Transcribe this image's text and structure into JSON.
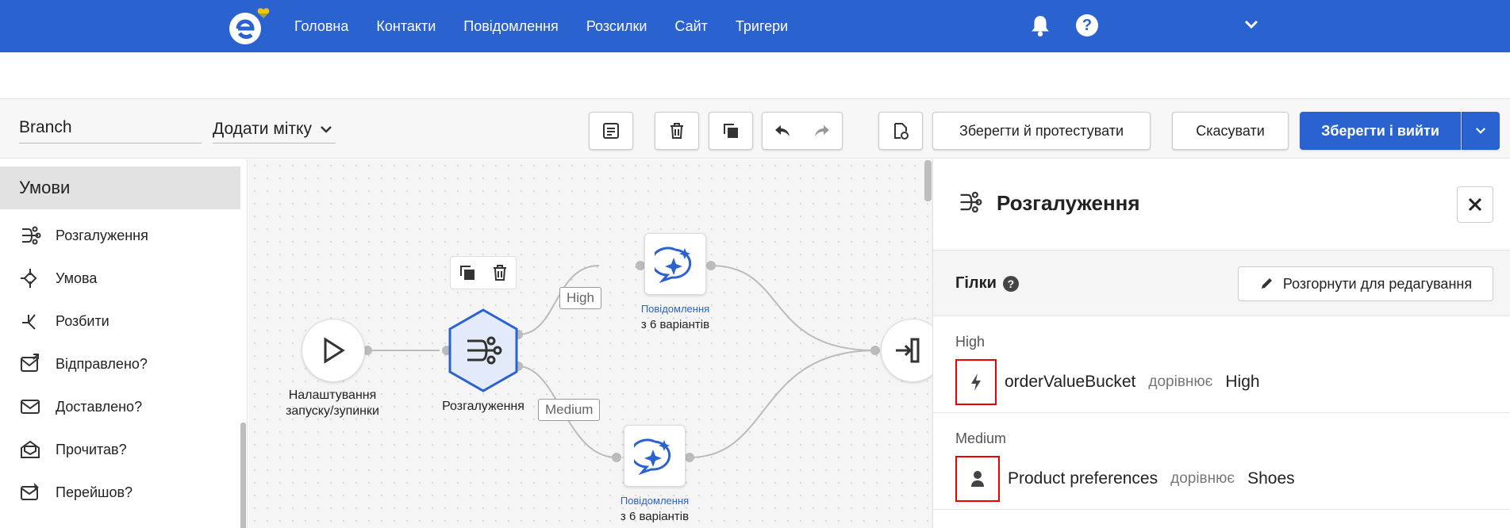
{
  "nav": {
    "links": [
      "Головна",
      "Контакти",
      "Повідомлення",
      "Розсилки",
      "Сайт",
      "Тригери"
    ],
    "colors": {
      "bar": "#2a62d0",
      "heart": "#f2c500"
    }
  },
  "toolbar": {
    "name_value": "Branch",
    "tag_label": "Додати мітку",
    "save_test_label": "Зберегти й протестувати",
    "cancel_label": "Скасувати",
    "save_exit_label": "Зберегти і вийти"
  },
  "sidebar": {
    "header": "Умови",
    "items": [
      {
        "label": "Розгалуження",
        "icon": "branch-icon"
      },
      {
        "label": "Умова",
        "icon": "condition-icon"
      },
      {
        "label": "Розбити",
        "icon": "split-icon"
      },
      {
        "label": "Відправлено?",
        "icon": "sent-icon"
      },
      {
        "label": "Доставлено?",
        "icon": "delivered-icon"
      },
      {
        "label": "Прочитав?",
        "icon": "read-icon"
      },
      {
        "label": "Перейшов?",
        "icon": "clicked-icon"
      }
    ]
  },
  "canvas": {
    "start_label": "Налаштування запуску/зупинки",
    "branch_label": "Розгалуження",
    "edge_high": "High",
    "edge_medium": "Medium",
    "msg_top": {
      "title": "Повідомлення",
      "sub": "з 6 варіантів"
    },
    "msg_bottom": {
      "title": "Повідомлення",
      "sub": "з 6 варіантів"
    }
  },
  "panel": {
    "title": "Розгалуження",
    "branches_title": "Гілки",
    "expand_label": "Розгорнути для редагування",
    "branches": [
      {
        "name": "High",
        "field": "orderValueBucket",
        "op": "дорівнює",
        "value": "High",
        "icon": "bolt-icon"
      },
      {
        "name": "Medium",
        "field": "Product preferences",
        "op": "дорівнює",
        "value": "Shoes",
        "icon": "person-icon"
      }
    ]
  }
}
